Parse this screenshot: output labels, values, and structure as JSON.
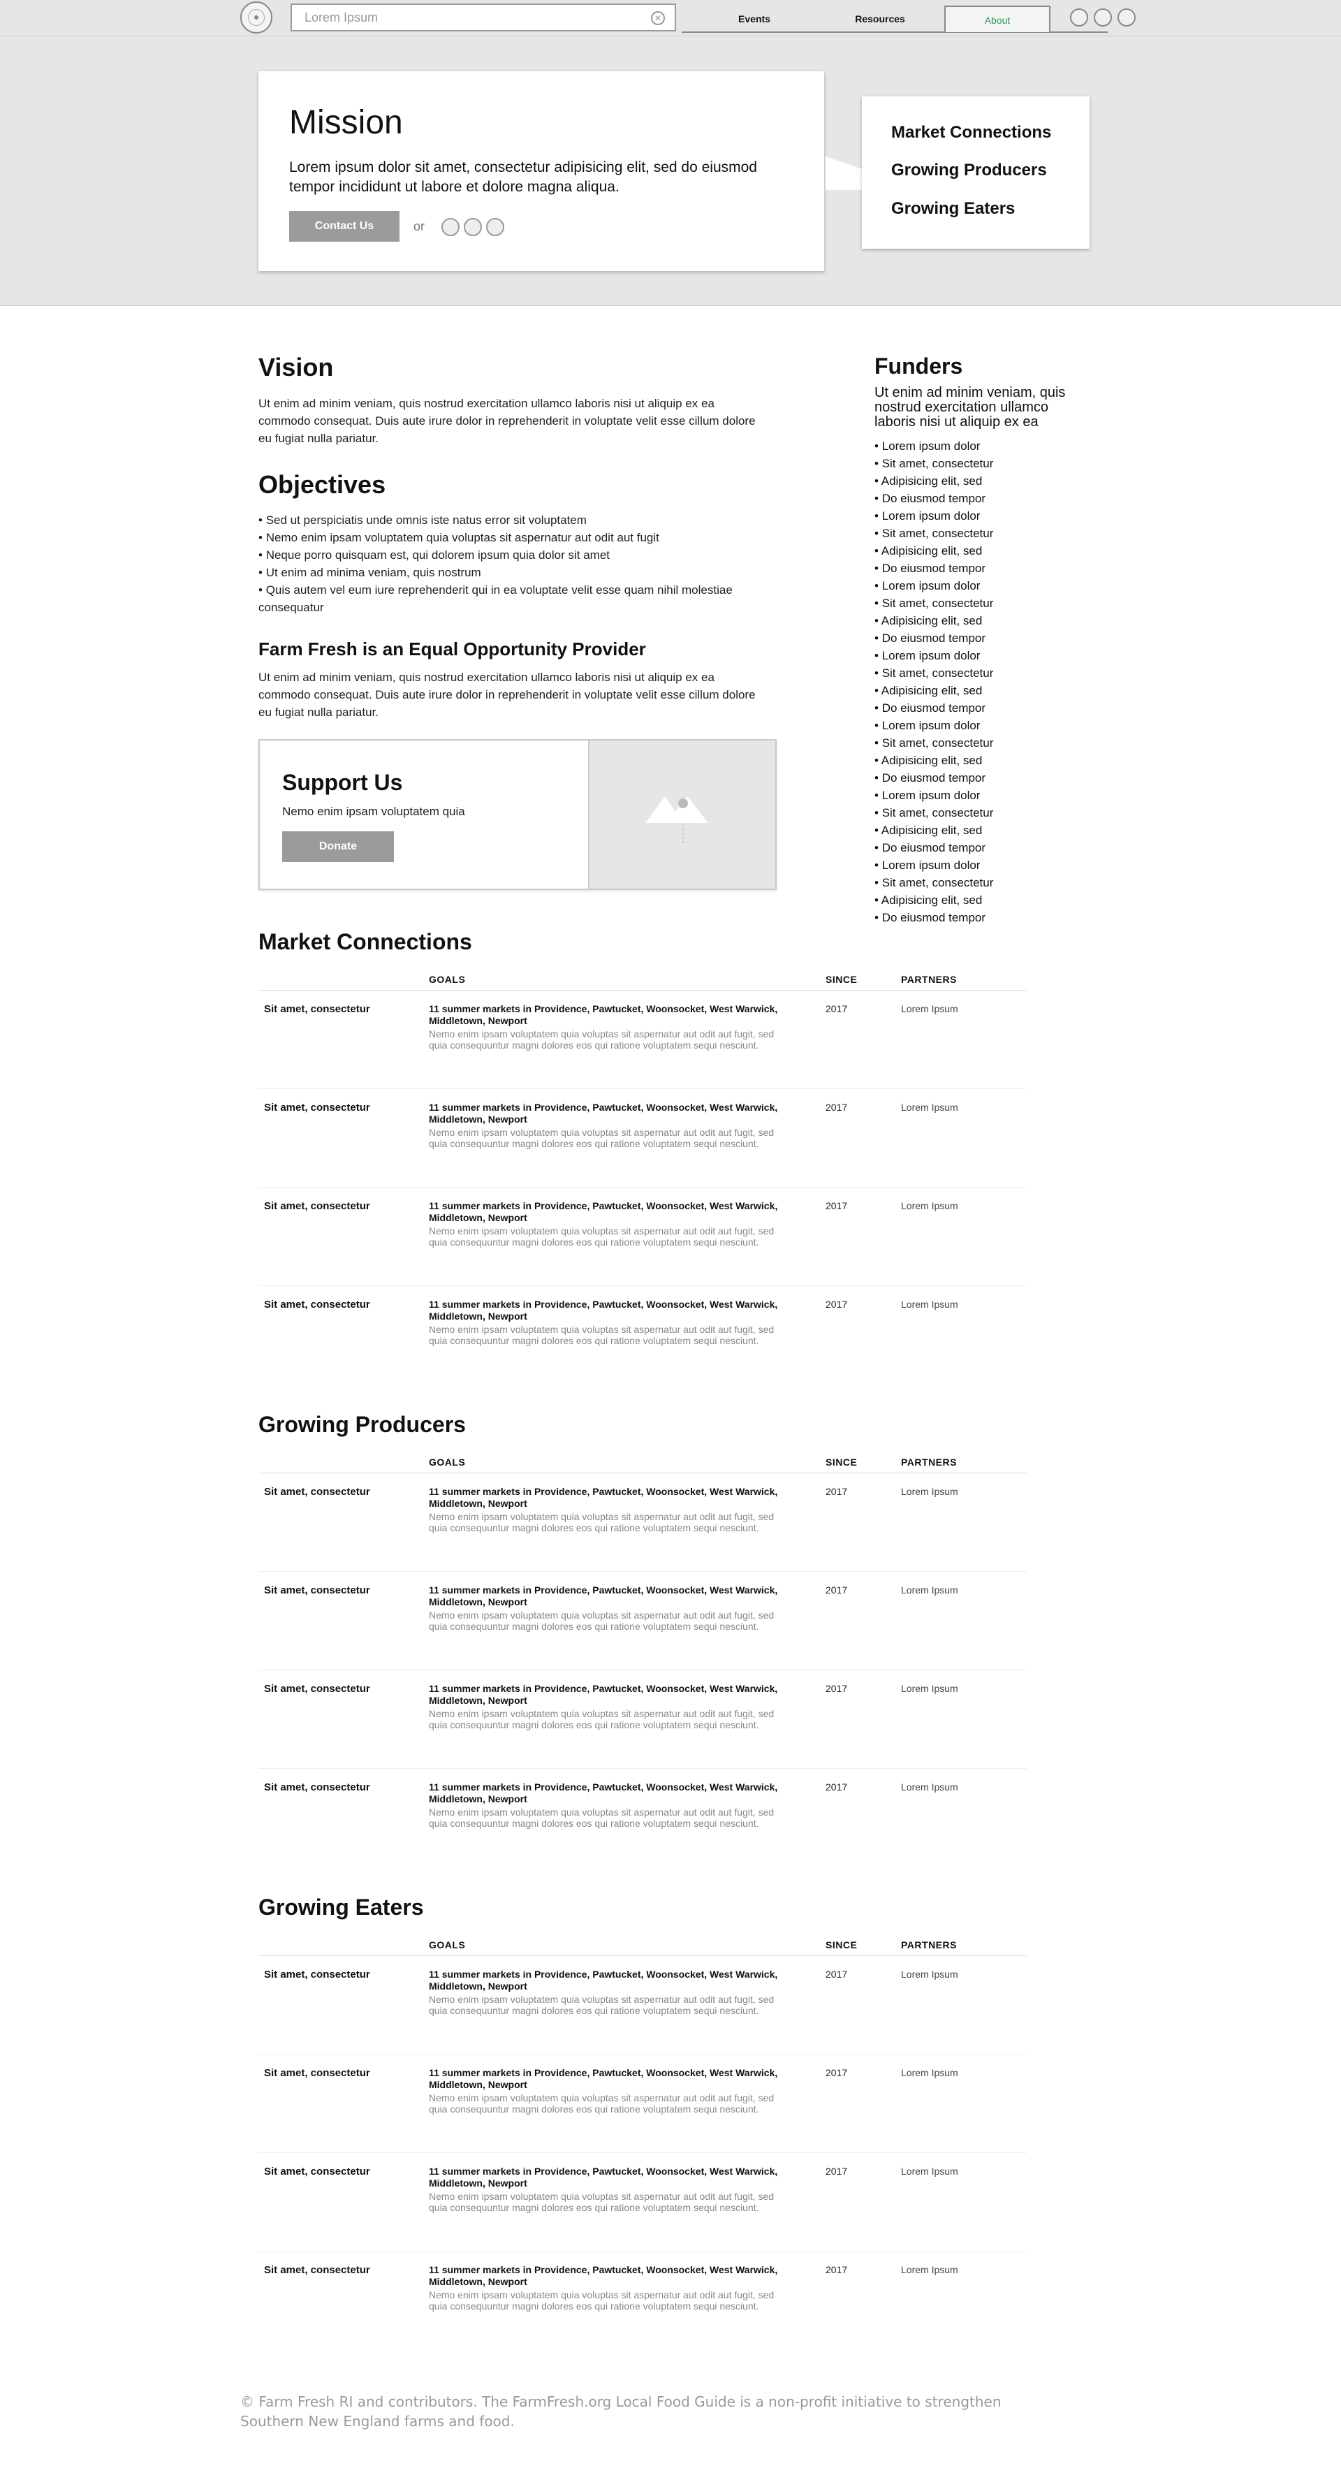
{
  "header": {
    "search_placeholder": "Lorem Ipsum",
    "nav": [
      "Events",
      "Resources",
      "About"
    ],
    "active_tab": "About",
    "active_color": "#2a9a4a"
  },
  "hero": {
    "title": "Mission",
    "text": "Lorem ipsum dolor sit amet, consectetur adipisicing elit, sed do eiusmod tempor incididunt ut labore et dolore magna aliqua.",
    "contact_label": "Contact Us",
    "or_label": "or",
    "menu": [
      "Market Connections",
      "Growing Producers",
      "Growing Eaters"
    ]
  },
  "vision": {
    "title": "Vision",
    "text": "Ut enim ad minim veniam, quis nostrud exercitation ullamco laboris nisi ut aliquip ex ea commodo consequat. Duis aute irure dolor in reprehenderit in voluptate velit esse cillum dolore eu fugiat nulla pariatur."
  },
  "objectives": {
    "title": "Objectives",
    "items": [
      "Sed ut perspiciatis unde omnis iste natus error sit voluptatem",
      "Nemo enim ipsam voluptatem quia voluptas sit aspernatur aut odit aut fugit",
      "Neque porro quisquam est, qui dolorem ipsum quia dolor sit amet",
      "Ut enim ad minima veniam, quis nostrum",
      "Quis autem vel eum iure reprehenderit qui in ea voluptate velit esse quam nihil molestiae consequatur"
    ]
  },
  "equal": {
    "title": "Farm Fresh is an Equal Opportunity Provider",
    "text": "Ut enim ad minim veniam, quis nostrud exercitation ullamco laboris nisi ut aliquip ex ea commodo consequat. Duis aute irure dolor in reprehenderit in voluptate velit esse cillum dolore eu fugiat nulla pariatur."
  },
  "support": {
    "title": "Support Us",
    "text": "Nemo enim ipsam voluptatem quia",
    "donate_label": "Donate"
  },
  "funders": {
    "title": "Funders",
    "subtitle": "Ut enim ad minim veniam, quis nostrud exercitation ullamco laboris nisi ut aliquip ex ea",
    "items": [
      "Lorem ipsum dolor",
      "Sit amet, consectetur",
      "Adipisicing elit, sed",
      "Do eiusmod tempor",
      "Lorem ipsum dolor",
      "Sit amet, consectetur",
      "Adipisicing elit, sed",
      "Do eiusmod tempor",
      "Lorem ipsum dolor",
      "Sit amet, consectetur",
      "Adipisicing elit, sed",
      "Do eiusmod tempor",
      "Lorem ipsum dolor",
      "Sit amet, consectetur",
      "Adipisicing elit, sed",
      "Do eiusmod tempor",
      "Lorem ipsum dolor",
      "Sit amet, consectetur",
      "Adipisicing elit, sed",
      "Do eiusmod tempor",
      "Lorem ipsum dolor",
      "Sit amet, consectetur",
      "Adipisicing elit, sed",
      "Do eiusmod tempor",
      "Lorem ipsum dolor",
      "Sit amet, consectetur",
      "Adipisicing elit, sed",
      "Do eiusmod tempor"
    ]
  },
  "table_headers": {
    "goals": "GOALS",
    "since": "SINCE",
    "partners": "PARTNERS"
  },
  "sections": [
    {
      "title": "Market Connections",
      "rows": [
        {
          "name": "Sit amet, consectetur",
          "goal": "11 summer markets in Providence, Pawtucket, Woonsocket, West Warwick, Middletown, Newport",
          "desc": "Nemo enim ipsam voluptatem quia voluptas sit aspernatur aut odit aut fugit, sed quia consequuntur magni dolores eos qui ratione voluptatem sequi nesciunt.",
          "since": "2017",
          "partner": "Lorem Ipsum"
        },
        {
          "name": "Sit amet, consectetur",
          "goal": "11 summer markets in Providence, Pawtucket, Woonsocket, West Warwick, Middletown, Newport",
          "desc": "Nemo enim ipsam voluptatem quia voluptas sit aspernatur aut odit aut fugit, sed quia consequuntur magni dolores eos qui ratione voluptatem sequi nesciunt.",
          "since": "2017",
          "partner": "Lorem Ipsum"
        },
        {
          "name": "Sit amet, consectetur",
          "goal": "11 summer markets in Providence, Pawtucket, Woonsocket, West Warwick, Middletown, Newport",
          "desc": "Nemo enim ipsam voluptatem quia voluptas sit aspernatur aut odit aut fugit, sed quia consequuntur magni dolores eos qui ratione voluptatem sequi nesciunt.",
          "since": "2017",
          "partner": "Lorem Ipsum"
        },
        {
          "name": "Sit amet, consectetur",
          "goal": "11 summer markets in Providence, Pawtucket, Woonsocket, West Warwick, Middletown, Newport",
          "desc": "Nemo enim ipsam voluptatem quia voluptas sit aspernatur aut odit aut fugit, sed quia consequuntur magni dolores eos qui ratione voluptatem sequi nesciunt.",
          "since": "2017",
          "partner": "Lorem Ipsum"
        }
      ]
    },
    {
      "title": "Growing Producers",
      "rows": [
        {
          "name": "Sit amet, consectetur",
          "goal": "11 summer markets in Providence, Pawtucket, Woonsocket, West Warwick, Middletown, Newport",
          "desc": "Nemo enim ipsam voluptatem quia voluptas sit aspernatur aut odit aut fugit, sed quia consequuntur magni dolores eos qui ratione voluptatem sequi nesciunt.",
          "since": "2017",
          "partner": "Lorem Ipsum"
        },
        {
          "name": "Sit amet, consectetur",
          "goal": "11 summer markets in Providence, Pawtucket, Woonsocket, West Warwick, Middletown, Newport",
          "desc": "Nemo enim ipsam voluptatem quia voluptas sit aspernatur aut odit aut fugit, sed quia consequuntur magni dolores eos qui ratione voluptatem sequi nesciunt.",
          "since": "2017",
          "partner": "Lorem Ipsum"
        },
        {
          "name": "Sit amet, consectetur",
          "goal": "11 summer markets in Providence, Pawtucket, Woonsocket, West Warwick, Middletown, Newport",
          "desc": "Nemo enim ipsam voluptatem quia voluptas sit aspernatur aut odit aut fugit, sed quia consequuntur magni dolores eos qui ratione voluptatem sequi nesciunt.",
          "since": "2017",
          "partner": "Lorem Ipsum"
        },
        {
          "name": "Sit amet, consectetur",
          "goal": "11 summer markets in Providence, Pawtucket, Woonsocket, West Warwick, Middletown, Newport",
          "desc": "Nemo enim ipsam voluptatem quia voluptas sit aspernatur aut odit aut fugit, sed quia consequuntur magni dolores eos qui ratione voluptatem sequi nesciunt.",
          "since": "2017",
          "partner": "Lorem Ipsum"
        }
      ]
    },
    {
      "title": "Growing Eaters",
      "rows": [
        {
          "name": "Sit amet, consectetur",
          "goal": "11 summer markets in Providence, Pawtucket, Woonsocket, West Warwick, Middletown, Newport",
          "desc": "Nemo enim ipsam voluptatem quia voluptas sit aspernatur aut odit aut fugit, sed quia consequuntur magni dolores eos qui ratione voluptatem sequi nesciunt.",
          "since": "2017",
          "partner": "Lorem Ipsum"
        },
        {
          "name": "Sit amet, consectetur",
          "goal": "11 summer markets in Providence, Pawtucket, Woonsocket, West Warwick, Middletown, Newport",
          "desc": "Nemo enim ipsam voluptatem quia voluptas sit aspernatur aut odit aut fugit, sed quia consequuntur magni dolores eos qui ratione voluptatem sequi nesciunt.",
          "since": "2017",
          "partner": "Lorem Ipsum"
        },
        {
          "name": "Sit amet, consectetur",
          "goal": "11 summer markets in Providence, Pawtucket, Woonsocket, West Warwick, Middletown, Newport",
          "desc": "Nemo enim ipsam voluptatem quia voluptas sit aspernatur aut odit aut fugit, sed quia consequuntur magni dolores eos qui ratione voluptatem sequi nesciunt.",
          "since": "2017",
          "partner": "Lorem Ipsum"
        },
        {
          "name": "Sit amet, consectetur",
          "goal": "11 summer markets in Providence, Pawtucket, Woonsocket, West Warwick, Middletown, Newport",
          "desc": "Nemo enim ipsam voluptatem quia voluptas sit aspernatur aut odit aut fugit, sed quia consequuntur magni dolores eos qui ratione voluptatem sequi nesciunt.",
          "since": "2017",
          "partner": "Lorem Ipsum"
        }
      ]
    }
  ],
  "footer": {
    "text": "© Farm Fresh RI and contributors. The FarmFresh.org Local Food Guide is a non-profit initiative to strengthen Southern New England farms and food."
  }
}
